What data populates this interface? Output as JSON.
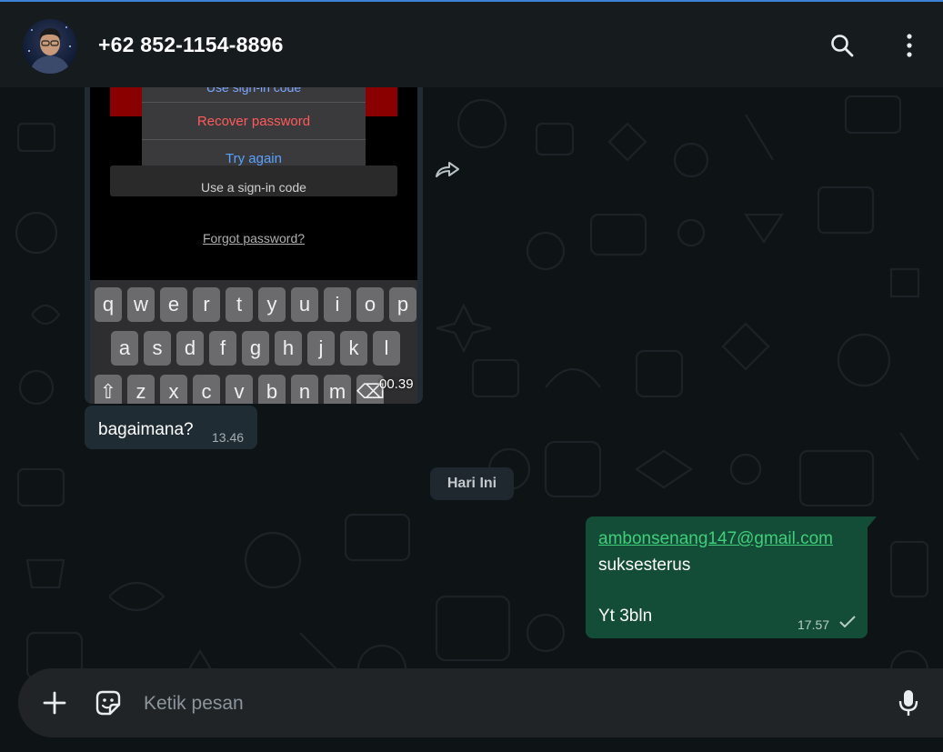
{
  "header": {
    "contact_name": "+62 852-1154-8896",
    "avatar_icon": "avatar",
    "search_icon": "search-icon",
    "menu_icon": "kebab-menu-icon"
  },
  "messages": {
    "media": {
      "screenshot_text": {
        "top_partial": "Use sign-in code",
        "recover": "Recover password",
        "try_again": "Try again",
        "signin_code": "Use a sign-in code",
        "forgot": "Forgot password?"
      },
      "keyboard_rows": [
        [
          "q",
          "w",
          "e",
          "r",
          "t",
          "y",
          "u",
          "i",
          "o",
          "p"
        ],
        [
          "a",
          "s",
          "d",
          "f",
          "g",
          "h",
          "j",
          "k",
          "l"
        ],
        [
          "⇧",
          "z",
          "x",
          "c",
          "v",
          "b",
          "n",
          "m",
          "⌫"
        ]
      ],
      "time": "00.39"
    },
    "incoming": {
      "text": "bagaimana?",
      "time": "13.46"
    },
    "date_separator": "Hari Ini",
    "outgoing": {
      "link": "ambonsenang147@gmail.com",
      "line1": "suksesterus",
      "line2": "Yt 3bln",
      "time": "17.57",
      "status_icon": "single-check-icon"
    }
  },
  "composer": {
    "placeholder": "Ketik pesan",
    "attach_icon": "plus-icon",
    "sticker_icon": "sticker-icon",
    "mic_icon": "mic-icon"
  },
  "colors": {
    "header_bg": "#161b1e",
    "chat_bg": "#0e1316",
    "incoming_bubble": "#202c33",
    "outgoing_bubble": "#144d37",
    "link_color": "#3fcf7a",
    "accent_line": "#3b82d6"
  }
}
